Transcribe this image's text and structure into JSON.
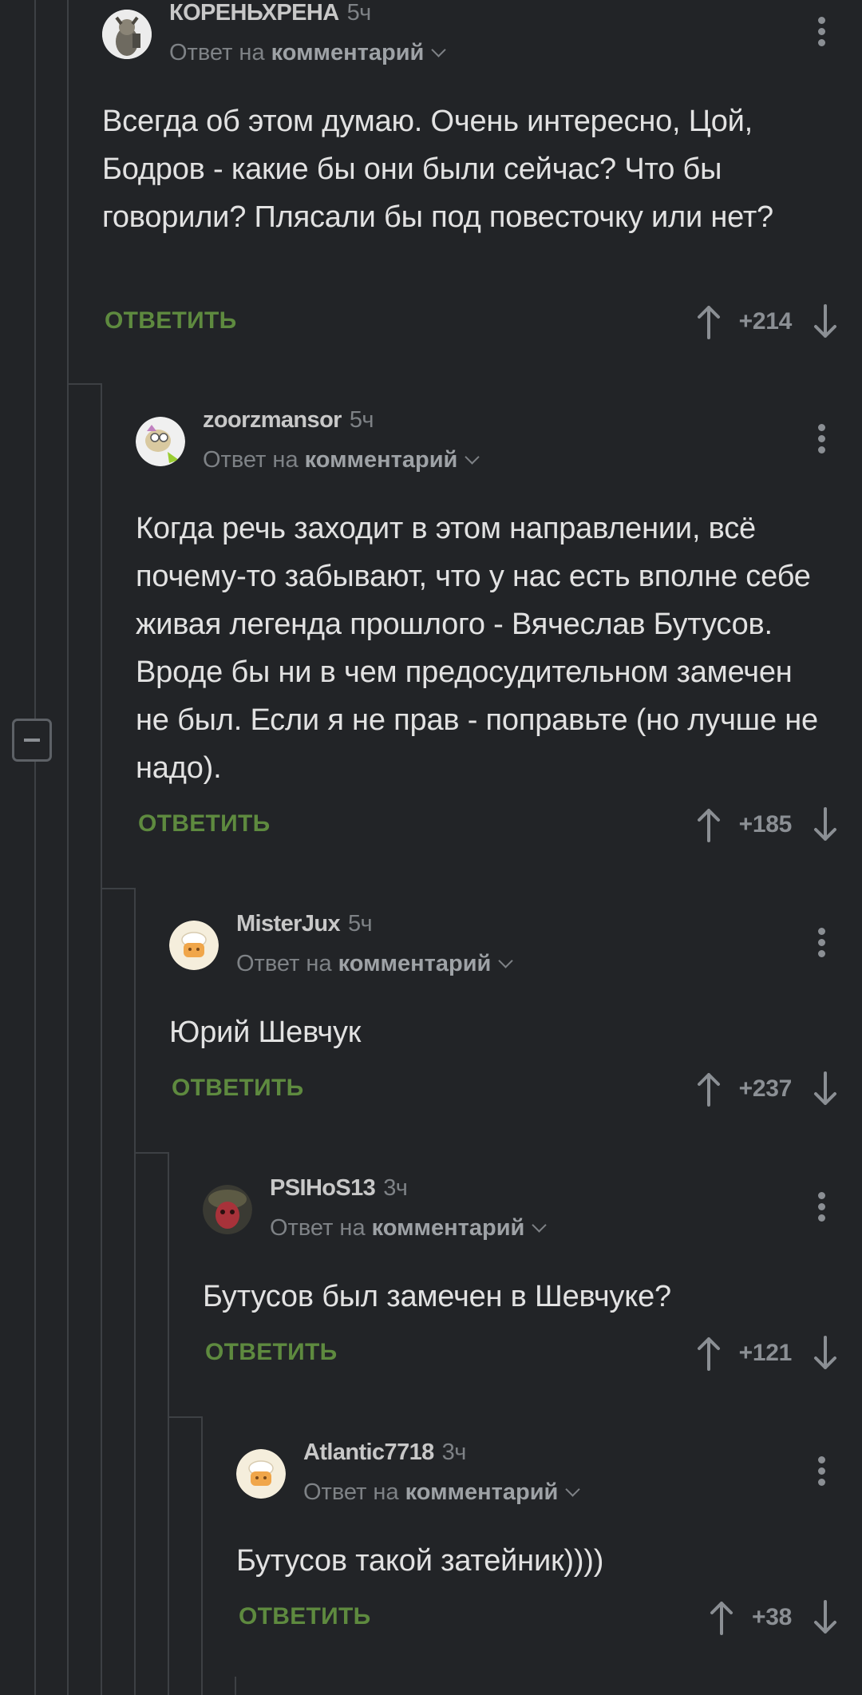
{
  "comments": [
    {
      "author": "КОРЕНЬХРЕНА",
      "time": "5ч",
      "reply_prefix": "Ответ на",
      "reply_target": "комментарий",
      "text": "Всегда об этом думаю. Очень интересно, Цой, Бодров - какие бы они были сейчас? Что бы говорили? Плясали бы под повесточку или нет?",
      "reply_label": "ОТВЕТИТЬ",
      "score": "+214"
    },
    {
      "author": "zoorzmansor",
      "time": "5ч",
      "reply_prefix": "Ответ на",
      "reply_target": "комментарий",
      "text": "Когда речь заходит в этом направлении, всё почему-то забывают, что у нас есть вполне себе живая легенда прошлого - Вячеслав Бутусов. Вроде бы ни в чем предосудительном замечен не был. Если я не прав - поправьте (но лучше не надо).",
      "reply_label": "ОТВЕТИТЬ",
      "score": "+185"
    },
    {
      "author": "MisterJux",
      "time": "5ч",
      "reply_prefix": "Ответ на",
      "reply_target": "комментарий",
      "text": "Юрий Шевчук",
      "reply_label": "ОТВЕТИТЬ",
      "score": "+237"
    },
    {
      "author": "PSIHoS13",
      "time": "3ч",
      "reply_prefix": "Ответ на",
      "reply_target": "комментарий",
      "text": "Бутусов был замечен в Шевчуке?",
      "reply_label": "ОТВЕТИТЬ",
      "score": "+121"
    },
    {
      "author": "Atlantic7718",
      "time": "3ч",
      "reply_prefix": "Ответ на",
      "reply_target": "комментарий",
      "text": "Бутусов такой затейник))))",
      "reply_label": "ОТВЕТИТЬ",
      "score": "+38"
    }
  ],
  "icons": {
    "collapse": "minus-square-icon",
    "upvote": "arrow-up-icon",
    "downvote": "arrow-down-icon",
    "more": "more-vertical-icon",
    "expand": "chevron-down-icon"
  },
  "colors": {
    "background": "#222427",
    "reply_accent": "#5e8a3f",
    "thread_line": "#3d4044"
  }
}
